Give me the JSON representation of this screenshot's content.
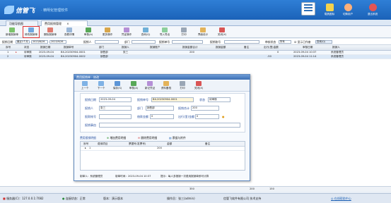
{
  "header": {
    "logo_text": "信管飞",
    "logo_sub": "· 精明化管理软件",
    "buttons": [
      {
        "label": "载具图标"
      },
      {
        "label": "切换用户"
      },
      {
        "label": "退出系统"
      }
    ]
  },
  "tabs": [
    {
      "label": "功能导航图"
    },
    {
      "label": "费用报销管理"
    }
  ],
  "toolbar": [
    {
      "label": "新增报销单"
    },
    {
      "label": "修改报销单"
    },
    {
      "label": "删除报销单"
    },
    {
      "label": "查看详情"
    },
    {
      "label": "审核(A)"
    },
    {
      "label": "更多操作"
    },
    {
      "label": "凭证操作"
    },
    {
      "label": "查询(Q)"
    },
    {
      "label": "导入导出"
    },
    {
      "label": "打印"
    },
    {
      "label": "界面设计"
    },
    {
      "label": "关闭(X)"
    }
  ],
  "filter": {
    "date_label": "报销日期",
    "date_mode": "最近1个月",
    "date_from": "2023/8/26",
    "date_to": "2023/9/26",
    "reporter_label": "报销人",
    "dept_label": "部门",
    "bill_label": "报销单号",
    "account_label": "报销账号",
    "audit_label": "审核状态",
    "audit_value": "所有",
    "show_closed": "显示已作废",
    "query_btn": "查询(Q)"
  },
  "grid": {
    "headers": [
      "序号",
      "状态",
      "报销日期",
      "报销单号",
      "部门",
      "报销人",
      "报销账户",
      "报销金额合计",
      "报销金额",
      "备注",
      "出行(里)金额",
      "审核日期",
      "报销人"
    ],
    "rows": [
      [
        "1",
        "待审核",
        "2023-09-04",
        "BX-20230904-0001",
        "销售部",
        "张三",
        "",
        "200",
        "",
        "",
        "0",
        "2023-09-04 10:37",
        "系统管理员"
      ],
      [
        "2",
        "待审核",
        "2023-09-04",
        "BX-20230904-0002",
        "销售部",
        "",
        "",
        "",
        "",
        "",
        "-50",
        "2023-09-04 11:14",
        "系统管理员"
      ]
    ],
    "sum_total": "350",
    "sum_amount": "200",
    "sum_mileage": "150"
  },
  "dialog": {
    "title": "费用报销单 - 修改",
    "toolbar": [
      {
        "label": "上一个"
      },
      {
        "label": "下一个"
      },
      {
        "label": "保存(S)"
      },
      {
        "label": "审核(A)"
      },
      {
        "label": "新记凭证"
      },
      {
        "label": "资料备档"
      },
      {
        "label": "打印"
      },
      {
        "label": "关闭(X)"
      }
    ],
    "fields": {
      "date_label": "报销日期",
      "date_value": "2023-09-04",
      "bill_label": "报销单号",
      "bill_value": "BX-20230904-0001",
      "status_label": "状态",
      "status_value": "待审核",
      "reporter_label": "报销人",
      "reporter_value": "张三",
      "dept_label": "部门",
      "dept_value": "销售部",
      "total_label": "报销合计",
      "total_value": "200",
      "account_label": "报款帐号",
      "amount_label": "借款金额",
      "amount_value": "0",
      "mileage_label": "出行(里)金额",
      "mileage_value": "0",
      "reason_label": "报销事由"
    },
    "detail_tabs": {
      "items_label": "费用报销明细",
      "add_label": "增加费用明细",
      "delete_label": "删除费用明细",
      "receipt_label": "票据与附件"
    },
    "detail_headers": [
      "序号",
      "费用项目",
      "票据号(发票号)",
      "金额",
      "备注"
    ],
    "detail_rows": [
      [
        "1",
        "",
        "",
        "200",
        ""
      ]
    ],
    "footer": {
      "creator": "制单人：系统管理员",
      "created": "制单时间：2023-09-04 10:37",
      "tip": "提示：每人多报销一次费用报销单即可计算"
    }
  },
  "status": {
    "server": "服务器(C)：127.0.0.1:7082",
    "conn": "连接状态：正常",
    "version": "版本：演示版本",
    "operator": "操作员：张三(admin)",
    "company": "信管飞软件有限公司 技术支持",
    "help_link": "在线帮助中心"
  }
}
